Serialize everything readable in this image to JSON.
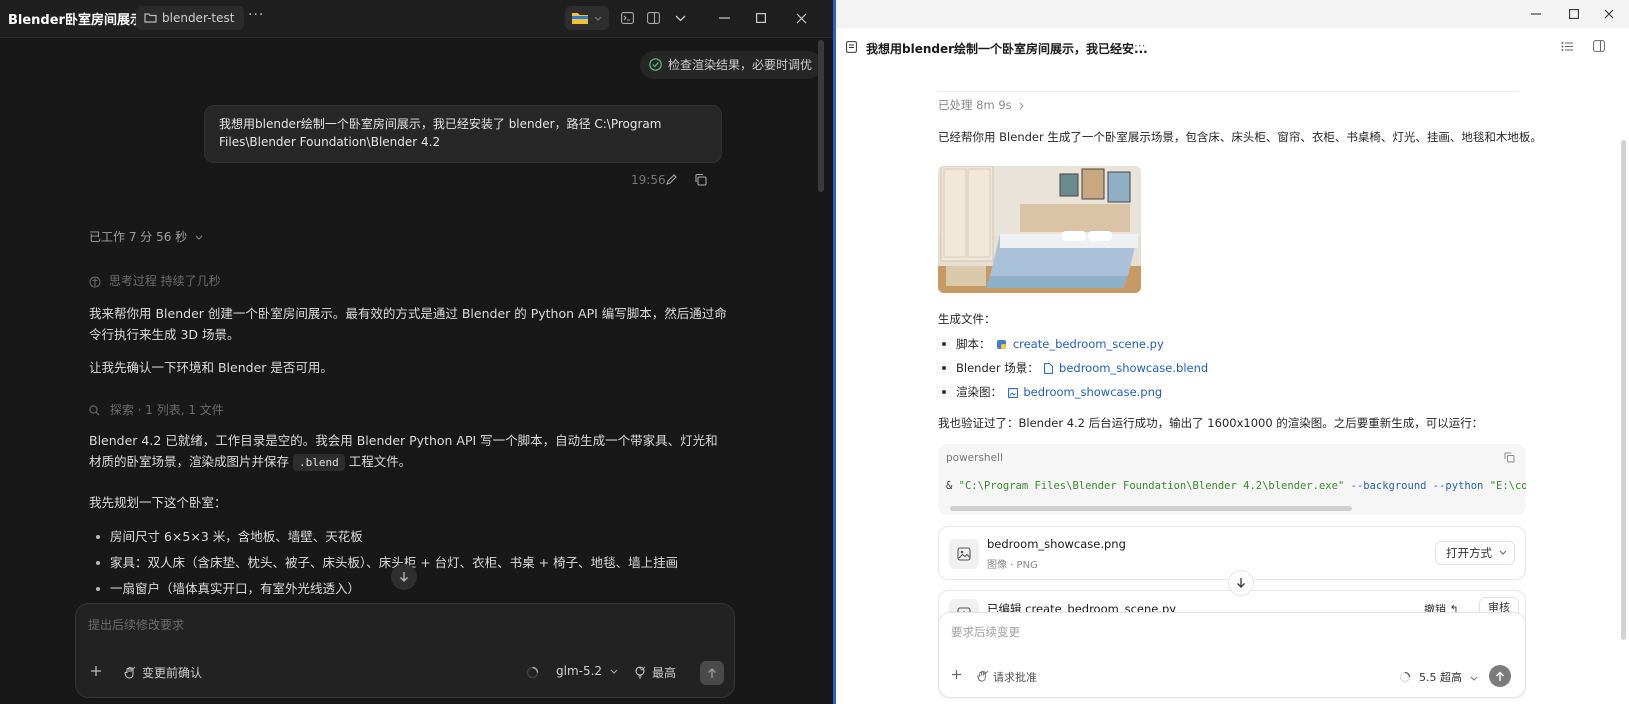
{
  "left": {
    "app_title": "Blender卧室房间展示",
    "folder": "blender-test",
    "more": "···",
    "status_pill": "检查渲染结果，必要时调优",
    "user_message": "我想用blender绘制一个卧室房间展示，我已经安装了 blender，路径 C:\\Program Files\\Blender Foundation\\Blender 4.2",
    "time": "19:56",
    "worked": "已工作 7 分 56 秒",
    "thinking": "思考过程  持续了几秒",
    "para1": "我来帮你用 Blender 创建一个卧室房间展示。最有效的方式是通过 Blender 的 Python API 编写脚本，然后通过命令行执行来生成 3D 场景。",
    "para2": "让我先确认一下环境和 Blender 是否可用。",
    "search": "探索 · 1 列表, 1 文件",
    "para3_a": "Blender 4.2 已就绪，工作目录是空的。我会用 Blender Python API 写一个脚本，自动生成一个带家具、灯光和材质的卧室场景，渲染成图片并保存",
    "para3_code": ".blend",
    "para3_b": "工程文件。",
    "para4": "我先规划一下这个卧室：",
    "bullets": [
      "房间尺寸 6×5×3 米，含地板、墙壁、天花板",
      "家具：双人床（含床垫、枕头、被子、床头板）、床头柜 + 台灯、衣柜、书桌 + 椅子、地毯、墙上挂画",
      "一扇窗户（墙体真实开口，有室外光线透入）"
    ],
    "composer": {
      "placeholder": "提出后续修改要求",
      "confirm": "变更前确认",
      "model": "glm-5.2",
      "effort": "最高"
    }
  },
  "right": {
    "title": "我想用blender绘制一个卧室房间展示，我已经安...",
    "more": "···",
    "processed": "已处理 8m 9s",
    "intro": "已经帮你用 Blender 生成了一个卧室展示场景，包含床、床头柜、窗帘、衣柜、书桌椅、灯光、挂画、地毯和木地板。",
    "files_heading": "生成文件：",
    "files": [
      {
        "label": "脚本：",
        "name": "create_bedroom_scene.py"
      },
      {
        "label": "Blender 场景：",
        "name": "bedroom_showcase.blend"
      },
      {
        "label": "渲染图：",
        "name": "bedroom_showcase.png"
      }
    ],
    "verify": "我也验证过了：Blender 4.2 后台运行成功，输出了 1600x1000 的渲染图。之后要重新生成，可以运行：",
    "code": {
      "lang": "powershell",
      "amp": "& ",
      "exe": "\"C:\\Program Files\\Blender Foundation\\Blender 4.2\\blender.exe\"",
      "flag1": " --background",
      "flag2": " --python",
      "path": " \"E:\\code\\"
    },
    "card1": {
      "name": "bedroom_showcase.png",
      "sub": "图像 · PNG",
      "action": "打开方式"
    },
    "card2": {
      "name": "已编辑 create_bedroom_scene.py",
      "undo": "撤销 ↰",
      "review": "审核"
    },
    "composer": {
      "placeholder": "要求后续变更",
      "approve": "请求批准",
      "model": "5.5  超高"
    }
  },
  "colors": {
    "accent": "#2563c7",
    "link": "#1f5fbf",
    "left_bg": "#181818",
    "right_bg": "#ffffff"
  }
}
